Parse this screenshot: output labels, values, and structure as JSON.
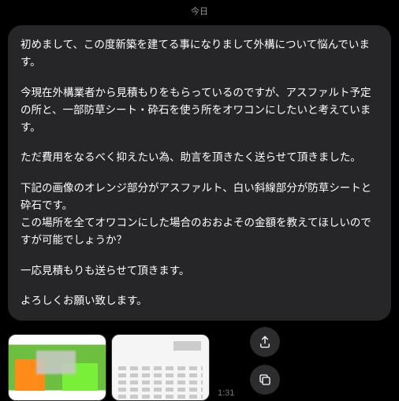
{
  "header": {
    "date_label": "今日"
  },
  "message": {
    "paragraphs": [
      "初めまして、この度新築を建てる事になりまして外構について悩んでいます。",
      "今現在外構業者から見積もりをもらっているのですが、アスファルト予定の所と、一部防草シート・砕石を使う所をオワコンにしたいと考えています。",
      "ただ費用をなるべく抑えたい為、助言を頂きたく送らせて頂きました。",
      "下記の画像のオレンジ部分がアスファルト、白い斜線部分が防草シートと砕石です。\nこの場所を全てオワコンにした場合のおおよその金額を教えてほしいのですが可能でしょうか？",
      "一応見積もりも送らせて頂きます。",
      "よろしくお願い致します。"
    ]
  },
  "attachments": [
    {
      "type": "plan",
      "label": "site-plan"
    },
    {
      "type": "doc",
      "label": "estimate-doc"
    }
  ],
  "timestamp": "1:31"
}
